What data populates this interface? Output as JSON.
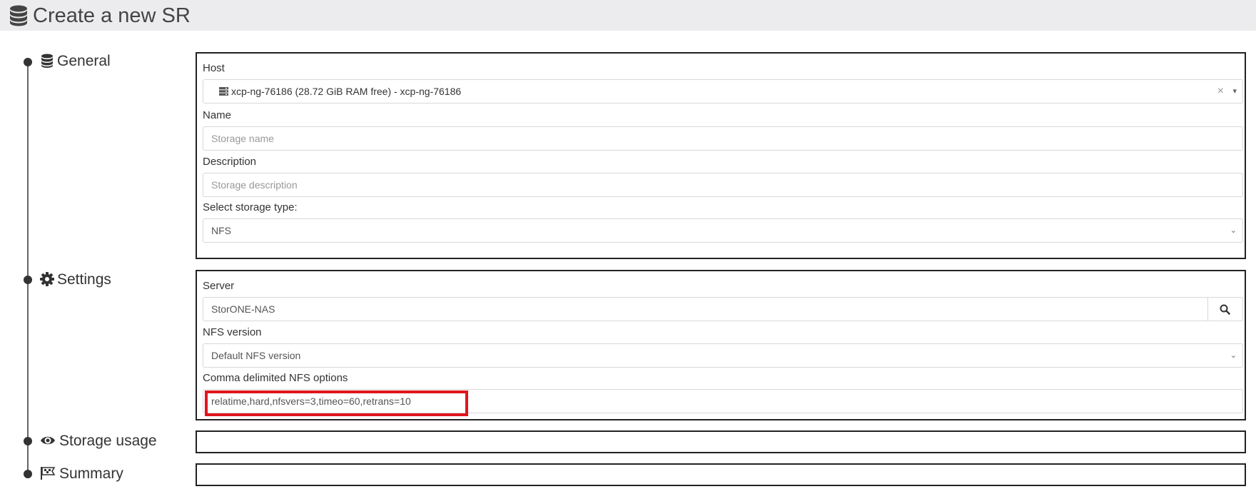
{
  "header": {
    "title": "Create a new SR",
    "icon": "database-icon"
  },
  "steps": [
    {
      "label": "General",
      "icon": "database-icon"
    },
    {
      "label": "Settings",
      "icon": "gear-icon"
    },
    {
      "label": "Storage usage",
      "icon": "eye-icon"
    },
    {
      "label": "Summary",
      "icon": "flag-icon"
    }
  ],
  "general": {
    "host_label": "Host",
    "host_value": "xcp-ng-76186 (28.72 GiB RAM free) - xcp-ng-76186",
    "host_clear": "×",
    "name_label": "Name",
    "name_placeholder": "Storage name",
    "description_label": "Description",
    "description_placeholder": "Storage description",
    "type_label": "Select storage type:",
    "type_value": "NFS"
  },
  "settings": {
    "server_label": "Server",
    "server_value": "StorONE-NAS",
    "nfs_version_label": "NFS version",
    "nfs_version_value": "Default NFS version",
    "nfs_options_label": "Comma delimited NFS options",
    "nfs_options_value": "relatime,hard,nfsvers=3,timeo=60,retrans=10"
  },
  "colors": {
    "highlight": "#e0161e",
    "header_bg": "#ececee"
  }
}
